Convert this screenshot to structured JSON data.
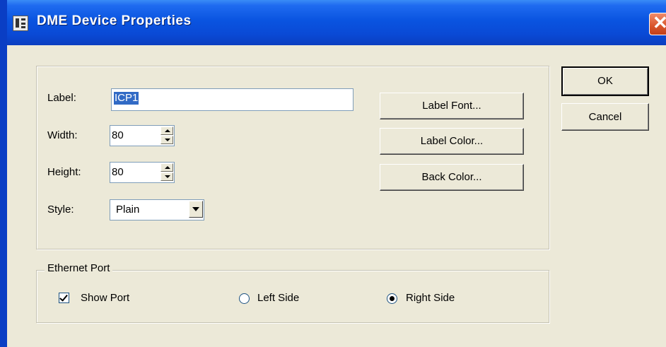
{
  "window": {
    "title": "DME Device Properties"
  },
  "fields": {
    "label_caption": "Label:",
    "label_value": "ICP1",
    "width_caption": "Width:",
    "width_value": "80",
    "height_caption": "Height:",
    "height_value": "80",
    "style_caption": "Style:",
    "style_value": "Plain"
  },
  "buttons": {
    "label_font": "Label Font...",
    "label_color": "Label Color...",
    "back_color": "Back Color...",
    "ok": "OK",
    "cancel": "Cancel"
  },
  "ethernet": {
    "group_title": "Ethernet Port",
    "show_port": {
      "label": "Show Port",
      "checked": true
    },
    "left_side": {
      "label": "Left Side",
      "selected": false
    },
    "right_side": {
      "label": "Right Side",
      "selected": true
    }
  },
  "icons": {
    "app": "dme-device-icon",
    "close": "close-icon"
  },
  "colors": {
    "titlebar": "#0a54e0",
    "dialog_bg": "#ece9d8",
    "selection": "#316ac5",
    "close": "#d9542a"
  }
}
